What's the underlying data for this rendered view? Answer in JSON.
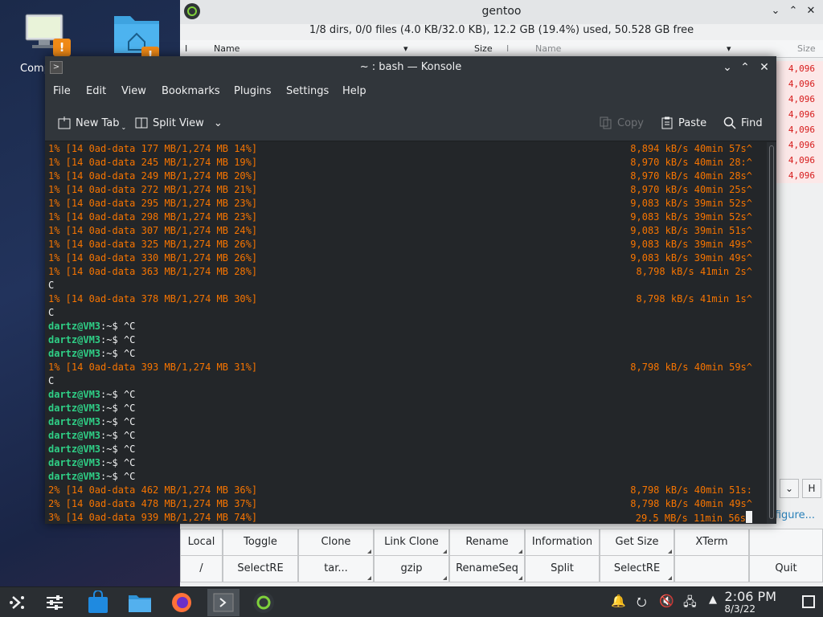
{
  "desktop": {
    "computer_label": "Comp",
    "warn_glyph": "!"
  },
  "file_manager": {
    "title": "gentoo",
    "info": "1/8 dirs, 0/0 files (4.0 KB/32.0 KB), 12.2 GB (19.4%) used, 50.528 GB free",
    "left_cols": {
      "flag": "I",
      "name": "Name",
      "size": "Size"
    },
    "right_cols": {
      "flag": "I",
      "name": "Name",
      "size": "Size"
    },
    "right_sizes": [
      "4,096",
      "4,096",
      "4,096",
      "4,096",
      "4,096",
      "4,096",
      "4,096",
      "4,096"
    ],
    "figure_link": "figure...",
    "ctl_h": "H",
    "buttons_row1": [
      "Local",
      "Toggle",
      "Clone",
      "Link Clone",
      "Rename",
      "Information",
      "Get Size",
      "XTerm",
      ""
    ],
    "buttons_row2": [
      "/",
      "SelectRE",
      "tar...",
      "gzip",
      "RenameSeq",
      "Split",
      "SelectRE",
      "",
      "Quit"
    ]
  },
  "konsole": {
    "title": "~ : bash — Konsole",
    "menu": [
      "File",
      "Edit",
      "View",
      "Bookmarks",
      "Plugins",
      "Settings",
      "Help"
    ],
    "toolbar": {
      "new_tab": "New Tab",
      "split_view": "Split View",
      "copy": "Copy",
      "paste": "Paste",
      "find": "Find"
    },
    "prompt": "dartz@VM3",
    "prompt_suffix": ":~$ ",
    "lines": [
      {
        "type": "prog",
        "left": "1% [14 0ad-data 177 MB/1,274 MB 14%]",
        "right": "8,894 kB/s 40min 57s^"
      },
      {
        "type": "prog",
        "left": "1% [14 0ad-data 245 MB/1,274 MB 19%]",
        "right": "8,970 kB/s 40min 28:^"
      },
      {
        "type": "prog",
        "left": "1% [14 0ad-data 249 MB/1,274 MB 20%]",
        "right": "8,970 kB/s 40min 28s^"
      },
      {
        "type": "prog",
        "left": "1% [14 0ad-data 272 MB/1,274 MB 21%]",
        "right": "8,970 kB/s 40min 25s^"
      },
      {
        "type": "prog",
        "left": "1% [14 0ad-data 295 MB/1,274 MB 23%]",
        "right": "9,083 kB/s 39min 52s^"
      },
      {
        "type": "prog",
        "left": "1% [14 0ad-data 298 MB/1,274 MB 23%]",
        "right": "9,083 kB/s 39min 52s^"
      },
      {
        "type": "prog",
        "left": "1% [14 0ad-data 307 MB/1,274 MB 24%]",
        "right": "9,083 kB/s 39min 51s^"
      },
      {
        "type": "prog",
        "left": "1% [14 0ad-data 325 MB/1,274 MB 26%]",
        "right": "9,083 kB/s 39min 49s^"
      },
      {
        "type": "prog",
        "left": "1% [14 0ad-data 330 MB/1,274 MB 26%]",
        "right": "9,083 kB/s 39min 49s^"
      },
      {
        "type": "prog",
        "left": "1% [14 0ad-data 363 MB/1,274 MB 28%]",
        "right": "8,798 kB/s 41min 2s^"
      },
      {
        "type": "plain",
        "text": "C"
      },
      {
        "type": "prog",
        "left": "1% [14 0ad-data 378 MB/1,274 MB 30%]",
        "right": "8,798 kB/s 41min 1s^"
      },
      {
        "type": "plain",
        "text": "C"
      },
      {
        "type": "prompt",
        "cmd": "^C"
      },
      {
        "type": "prompt",
        "cmd": "^C"
      },
      {
        "type": "prompt",
        "cmd": "^C"
      },
      {
        "type": "prog",
        "left": "1% [14 0ad-data 393 MB/1,274 MB 31%]",
        "right": "8,798 kB/s 40min 59s^"
      },
      {
        "type": "plain",
        "text": "C"
      },
      {
        "type": "prompt",
        "cmd": "^C"
      },
      {
        "type": "prompt",
        "cmd": "^C"
      },
      {
        "type": "prompt",
        "cmd": "^C"
      },
      {
        "type": "prompt",
        "cmd": "^C"
      },
      {
        "type": "prompt",
        "cmd": "^C"
      },
      {
        "type": "prompt",
        "cmd": "^C"
      },
      {
        "type": "prompt",
        "cmd": "^C"
      },
      {
        "type": "prog",
        "left": "2% [14 0ad-data 462 MB/1,274 MB 36%]",
        "right": "8,798 kB/s 40min 51s:"
      },
      {
        "type": "prog",
        "left": "2% [14 0ad-data 478 MB/1,274 MB 37%]",
        "right": "8,798 kB/s 40min 49s^"
      },
      {
        "type": "prog",
        "left": "3% [14 0ad-data 939 MB/1,274 MB 74%]",
        "right": "29.5 MB/s 11min 56s",
        "cursor": true
      }
    ]
  },
  "taskbar": {
    "time": "2:06 PM",
    "date": "8/3/22"
  },
  "colors": {
    "terminal_bg": "#232629",
    "progress_text": "#f67400",
    "prompt_text": "#2fcf86",
    "size_text": "#d61a1a"
  }
}
